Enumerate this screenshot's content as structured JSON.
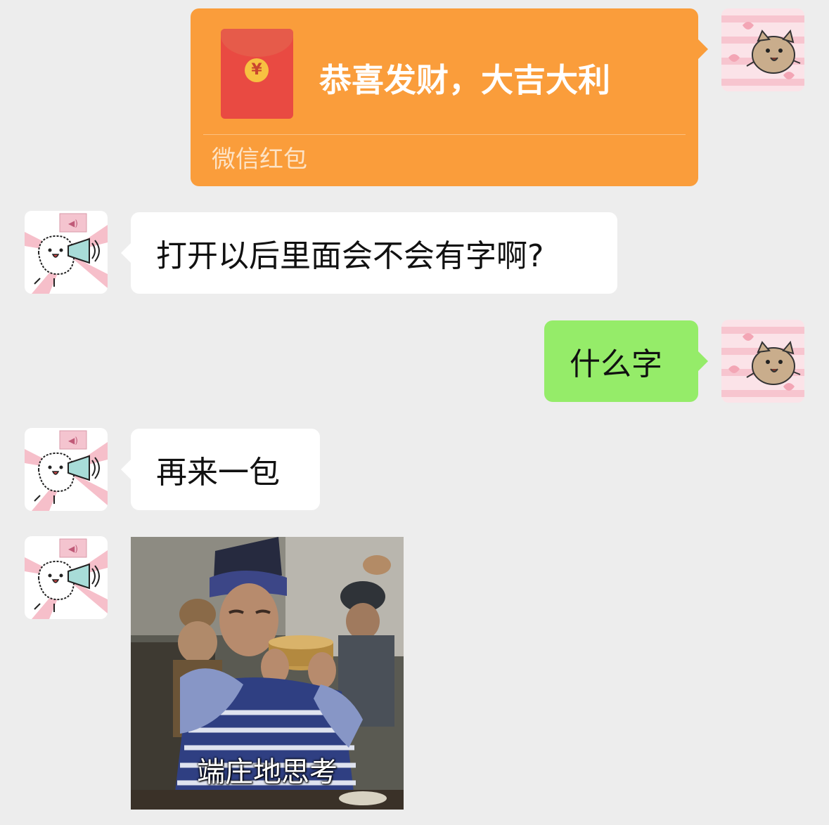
{
  "messages": {
    "red_packet": {
      "coin_symbol": "¥",
      "title": "恭喜发财，大吉大利",
      "label": "微信红包"
    },
    "incoming_1": {
      "text": "打开以后里面会不会有字啊?"
    },
    "outgoing_2": {
      "text": "什么字"
    },
    "incoming_3": {
      "text": "再来一包"
    },
    "sticker_4": {
      "caption": "端庄地思考"
    }
  },
  "avatars": {
    "self": "cartoon-cat-avatar",
    "contact": "cartoon-dog-megaphone-avatar"
  },
  "colors": {
    "background": "#ededed",
    "outgoing_bubble": "#95ec69",
    "incoming_bubble": "#ffffff",
    "red_packet_card": "#fa9d3b",
    "envelope": "#e94a42"
  }
}
